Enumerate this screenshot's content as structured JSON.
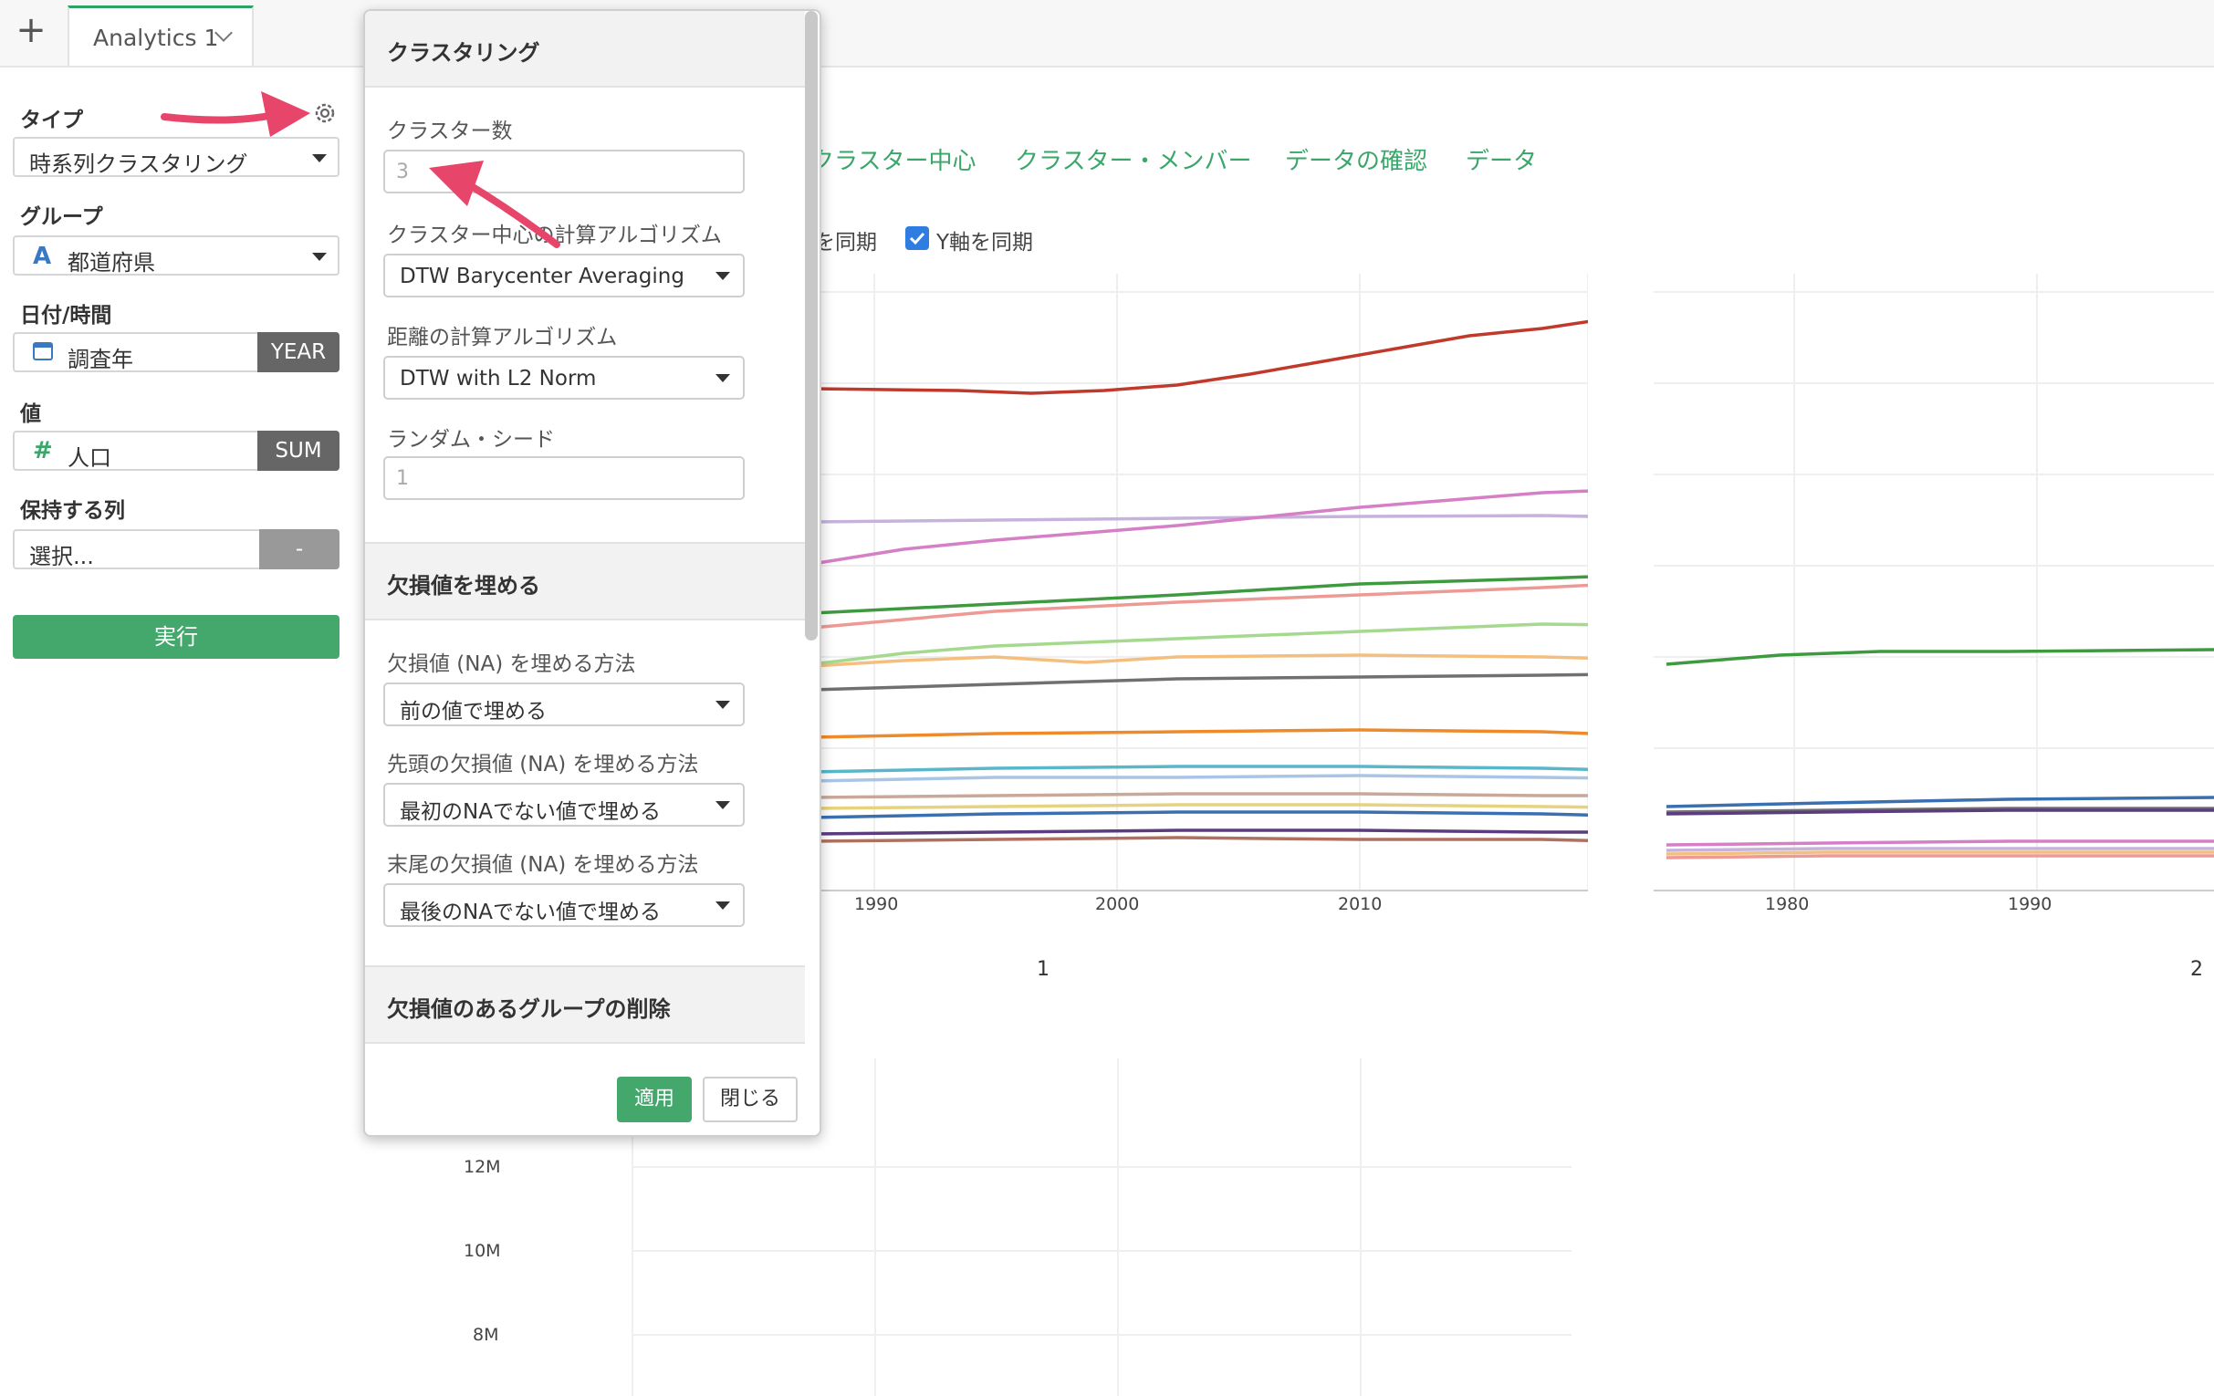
{
  "topbar": {
    "new_tab_symbol": "+",
    "tab_label": "Analytics 1"
  },
  "sidebar": {
    "type_label": "タイプ",
    "type_value": "時系列クラスタリング",
    "group_label": "グループ",
    "group_value": "都道府県",
    "group_icon_glyph": "A",
    "datetime_label": "日付/時間",
    "datetime_value": "調査年",
    "datetime_tag": "YEAR",
    "value_label": "値",
    "value_icon_glyph": "#",
    "value_value": "人口",
    "value_tag": "SUM",
    "keep_label": "保持する列",
    "keep_placeholder": "選択...",
    "keep_tag": "-",
    "run_label": "実行"
  },
  "result_tabs": [
    "クラスター中心",
    "クラスター・メンバー",
    "データの確認",
    "データ"
  ],
  "sync": {
    "x_sync_label": "を同期",
    "y_sync_label": "Y軸を同期",
    "y_sync_checked": true
  },
  "chart_labels": {
    "cluster1": "1",
    "cluster2": "2"
  },
  "chart_data": [
    {
      "type": "line",
      "title": "1",
      "x_ticks": [
        "1990",
        "2000",
        "2010"
      ],
      "xlim": [
        1975,
        2019
      ],
      "series_colors": [
        "#c0392b",
        "#c5b3dc",
        "#d57fc6",
        "#3e9a3e",
        "#ee9a94",
        "#a4d98e",
        "#f4bf7e",
        "#707070",
        "#ef8a2a",
        "#58b7c9",
        "#a9c5e6",
        "#c9a89a",
        "#e7d27e",
        "#3a6fb0",
        "#5b3d7e",
        "#b07060"
      ]
    },
    {
      "type": "line",
      "title": "2",
      "x_ticks": [
        "1980",
        "1990"
      ]
    },
    {
      "type": "line",
      "y_ticks": [
        "12M",
        "10M",
        "8M"
      ]
    }
  ],
  "popup": {
    "section1_title": "クラスタリング",
    "num_clusters_label": "クラスター数",
    "num_clusters_value": "3",
    "center_algo_label": "クラスター中心の計算アルゴリズム",
    "center_algo_value": "DTW Barycenter Averaging",
    "distance_algo_label": "距離の計算アルゴリズム",
    "distance_algo_value": "DTW with L2 Norm",
    "seed_label": "ランダム・シード",
    "seed_value": "1",
    "section2_title": "欠損値を埋める",
    "na_fill_label": "欠損値 (NA) を埋める方法",
    "na_fill_value": "前の値で埋める",
    "na_lead_label": "先頭の欠損値 (NA) を埋める方法",
    "na_lead_value": "最初のNAでない値で埋める",
    "na_trail_label": "末尾の欠損値 (NA) を埋める方法",
    "na_trail_value": "最後のNAでない値で埋める",
    "section3_title": "欠損値のあるグループの削除",
    "apply_label": "適用",
    "close_label": "閉じる"
  },
  "annotation_color": "#e8456a"
}
